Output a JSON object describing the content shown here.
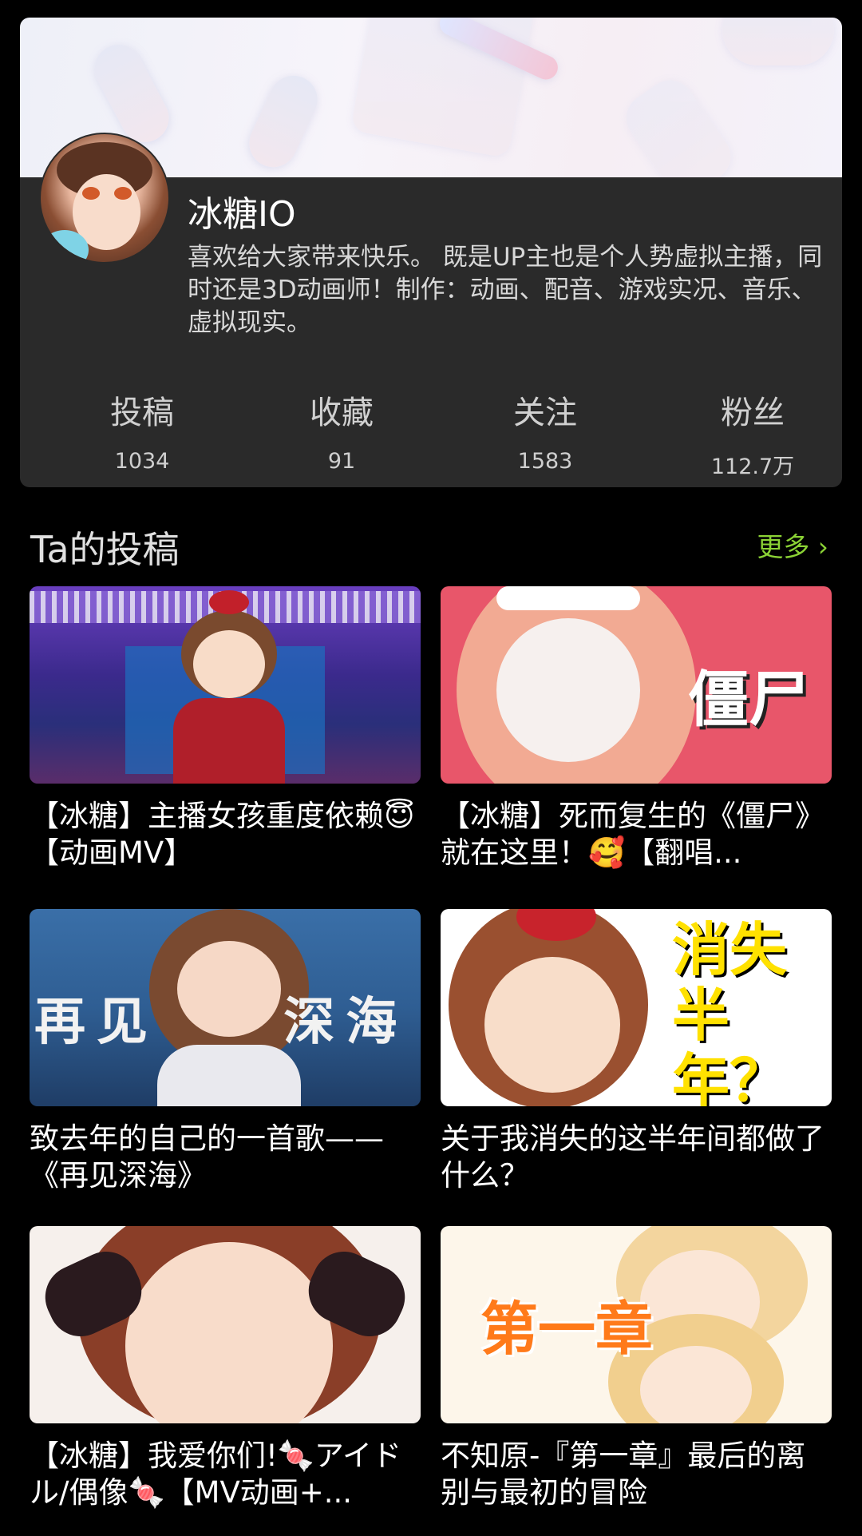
{
  "profile": {
    "name": "冰糖IO",
    "bio": "喜欢给大家带来快乐。 既是UP主也是个人势虚拟主播，同时还是3D动画师！制作：动画、配音、游戏实况、音乐、虚拟现实。",
    "stats": [
      {
        "label": "投稿",
        "value": "1034"
      },
      {
        "label": "收藏",
        "value": "91"
      },
      {
        "label": "关注",
        "value": "1583"
      },
      {
        "label": "粉丝",
        "value": "112.7万"
      }
    ]
  },
  "uploads": {
    "title": "Ta的投稿",
    "more_label": "更多 ›",
    "videos": [
      {
        "title": "【冰糖】主播女孩重度依赖😇【动画MV】",
        "thumb_text": ""
      },
      {
        "title": "【冰糖】死而复生的《僵尸》就在这里！🥰【翻唱...",
        "thumb_text": "僵尸"
      },
      {
        "title": "致去年的自己的一首歌——《再见深海》",
        "thumb_text": "再见 深海"
      },
      {
        "title": "关于我消失的这半年间都做了什么？",
        "thumb_text": "消失 半年？"
      },
      {
        "title": "【冰糖】我爱你们!🍬アイドル/偶像🍬【MV动画+...",
        "thumb_text": ""
      },
      {
        "title": "不知原-『第一章』最后的离别与最初的冒险",
        "thumb_text": "第一章"
      }
    ]
  },
  "colors": {
    "accent_green": "#8bd235",
    "card_bg": "#2a2a2a",
    "page_bg": "#000000"
  }
}
